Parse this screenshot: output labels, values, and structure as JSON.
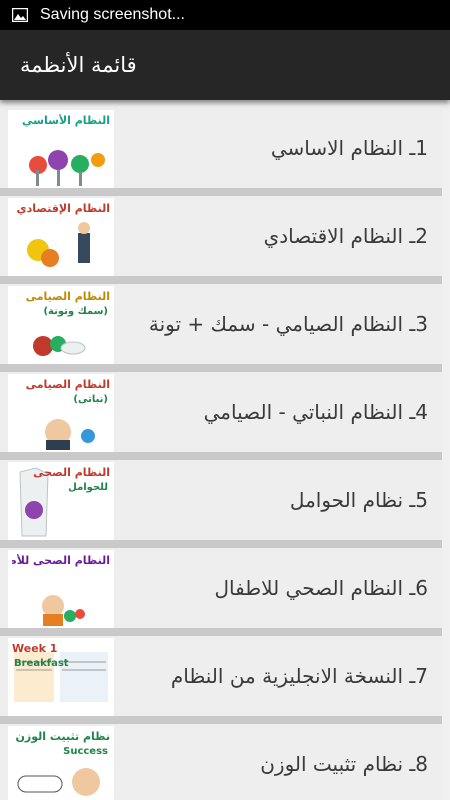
{
  "status_bar": {
    "icon": "image-icon",
    "text": "Saving screenshot..."
  },
  "app_bar": {
    "title": "قائمة الأنظمة"
  },
  "items": [
    {
      "label": "1ـ النظام الاساسي",
      "thumb_title": "النظام الأساسي",
      "thumb_title_color": "#16a085",
      "thumb_sub": ""
    },
    {
      "label": "2ـ النظام الاقتصادي",
      "thumb_title": "النظام الإقتصادي",
      "thumb_title_color": "#c0392b",
      "thumb_sub": ""
    },
    {
      "label": "3ـ النظام الصيامي - سمك + تونة",
      "thumb_title": "النظام الصيامى",
      "thumb_title_color": "#c08a00",
      "thumb_sub": "(سمك وتونة)"
    },
    {
      "label": "4ـ النظام النباتي - الصيامي",
      "thumb_title": "النظام الصيامى",
      "thumb_title_color": "#c0392b",
      "thumb_sub": "(نباتى)"
    },
    {
      "label": "5ـ نظام الحوامل",
      "thumb_title": "النظام الصحى",
      "thumb_title_color": "#c0392b",
      "thumb_sub": "للحوامل"
    },
    {
      "label": "6ـ النظام الصحي للاطفال",
      "thumb_title": "النظام الصحى للأطفال",
      "thumb_title_color": "#6a1b9a",
      "thumb_sub": ""
    },
    {
      "label": "7ـ النسخة الانجليزية من النظام",
      "thumb_title": "Week 1",
      "thumb_title_color": "#c0392b",
      "thumb_sub": "Breakfast"
    },
    {
      "label": "8ـ نظام تثبيت الوزن",
      "thumb_title": "نظام تثبيت الوزن",
      "thumb_title_color": "#1e8449",
      "thumb_sub": "Success"
    }
  ]
}
